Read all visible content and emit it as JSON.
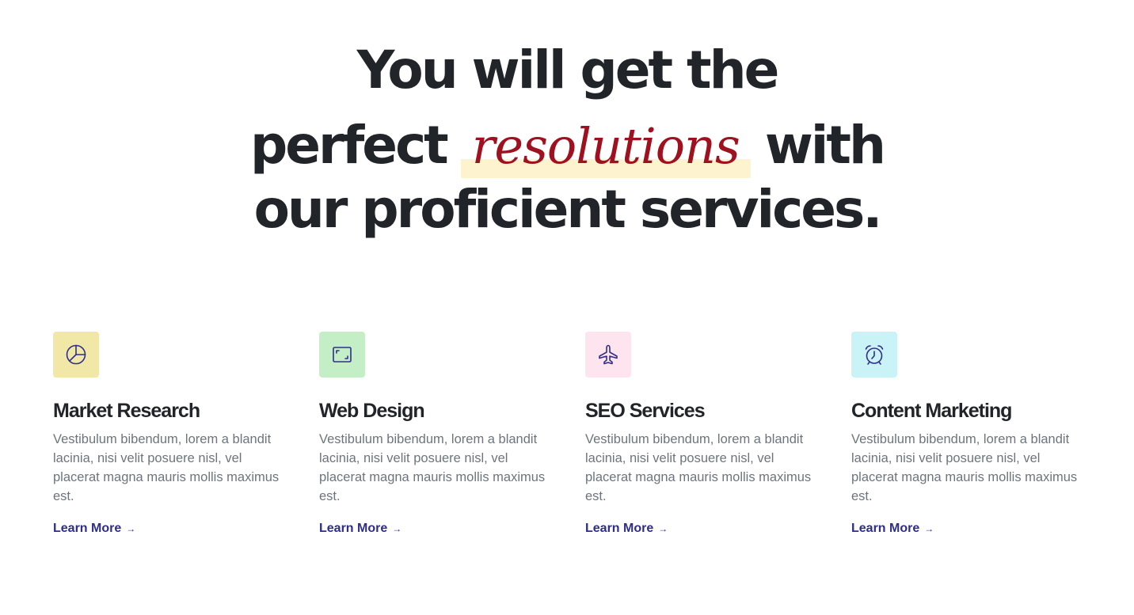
{
  "hero": {
    "line1": "You will get the",
    "line2_before": "perfect",
    "line2_accent": "resolutions",
    "line2_after": "with",
    "line3": "our proficient services."
  },
  "colors": {
    "heading": "#212529",
    "accent": "#a0111f",
    "highlight": "#fdf3cf",
    "link": "#2e2e8a",
    "body_text": "#6c757d"
  },
  "services": [
    {
      "icon": "pie-chart-icon",
      "icon_bg": "#f1e8a8",
      "title": "Market Research",
      "description": "Vestibulum bibendum, lorem a blandit lacinia, nisi velit posuere nisl, vel placerat magna mauris mollis maximus est.",
      "link_label": "Learn More",
      "link_arrow": "→"
    },
    {
      "icon": "frame-icon",
      "icon_bg": "#c4efc6",
      "title": "Web Design",
      "description": "Vestibulum bibendum, lorem a blandit lacinia, nisi velit posuere nisl, vel placerat magna mauris mollis maximus est.",
      "link_label": "Learn More",
      "link_arrow": "→"
    },
    {
      "icon": "airplane-icon",
      "icon_bg": "#fde4ee",
      "title": "SEO Services",
      "description": "Vestibulum bibendum, lorem a blandit lacinia, nisi velit posuere nisl, vel placerat magna mauris mollis maximus est.",
      "link_label": "Learn More",
      "link_arrow": "→"
    },
    {
      "icon": "alarm-clock-icon",
      "icon_bg": "#c9f3f6",
      "title": "Content Marketing",
      "description": "Vestibulum bibendum, lorem a blandit lacinia, nisi velit posuere nisl, vel placerat magna mauris mollis maximus est.",
      "link_label": "Learn More",
      "link_arrow": "→"
    }
  ]
}
